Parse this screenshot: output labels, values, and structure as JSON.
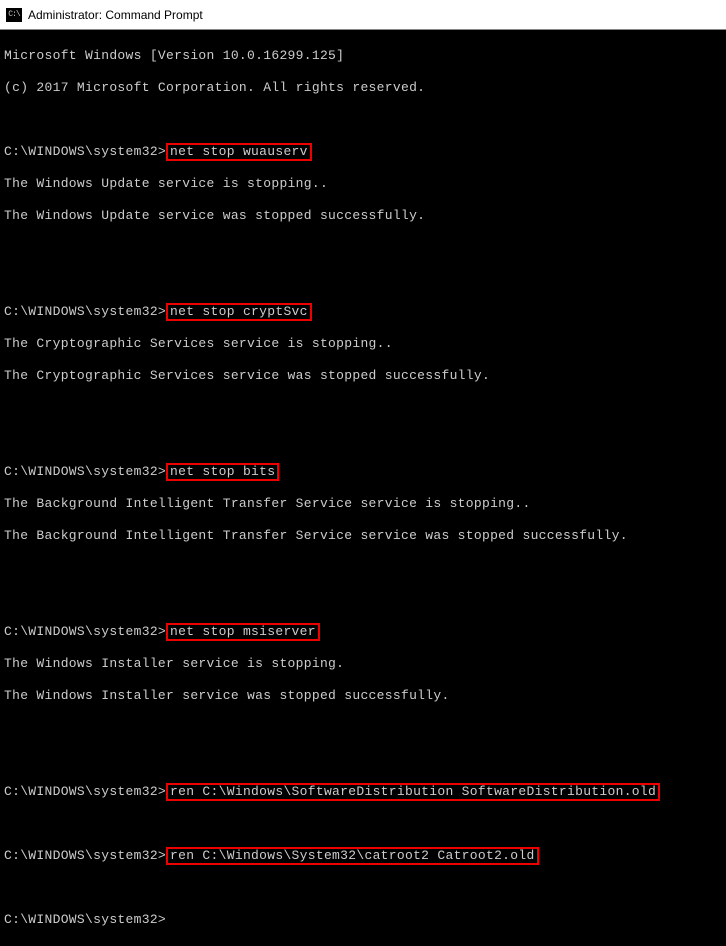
{
  "titlebar": {
    "title": "Administrator: Command Prompt",
    "icon_name": "cmd-icon"
  },
  "terminal": {
    "header1": "Microsoft Windows [Version 10.0.16299.125]",
    "header2": "(c) 2017 Microsoft Corporation. All rights reserved.",
    "prompt": "C:\\WINDOWS\\system32>",
    "blocks": [
      {
        "cmd": "net stop wuauserv",
        "out1": "The Windows Update service is stopping..",
        "out2": "The Windows Update service was stopped successfully."
      },
      {
        "cmd": "net stop cryptSvc",
        "out1": "The Cryptographic Services service is stopping..",
        "out2": "The Cryptographic Services service was stopped successfully."
      },
      {
        "cmd": "net stop bits",
        "out1": "The Background Intelligent Transfer Service service is stopping..",
        "out2": "The Background Intelligent Transfer Service service was stopped successfully."
      },
      {
        "cmd": "net stop msiserver",
        "out1": "The Windows Installer service is stopping.",
        "out2": "The Windows Installer service was stopped successfully."
      }
    ],
    "ren1": "ren C:\\Windows\\SoftwareDistribution SoftwareDistribution.old",
    "ren2": "ren C:\\Windows\\System32\\catroot2 Catroot2.old"
  }
}
